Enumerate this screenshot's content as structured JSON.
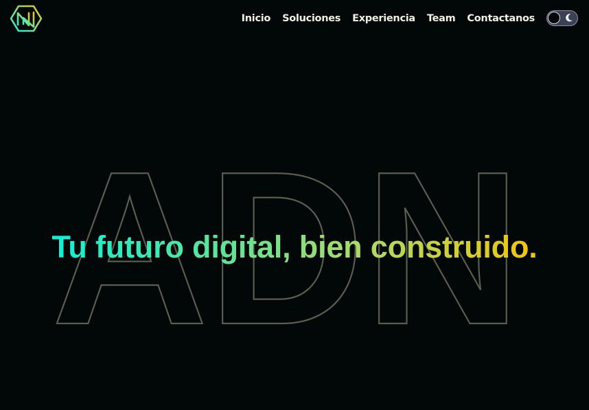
{
  "brand": {
    "logo_icon": "hexagon-n-logo-icon",
    "gradient_colors": [
      "#10f0d6",
      "#5ee39a",
      "#a8dc6a",
      "#f2c40a"
    ]
  },
  "nav": {
    "items": [
      {
        "label": "Inicio"
      },
      {
        "label": "Soluciones"
      },
      {
        "label": "Experiencia"
      },
      {
        "label": "Team"
      },
      {
        "label": "Contactanos"
      }
    ]
  },
  "theme_toggle": {
    "icon": "moon-icon",
    "mode": "dark"
  },
  "hero": {
    "background_word": "ADN",
    "title": "Tu futuro digital, bien construido."
  },
  "colors": {
    "background": "#020807",
    "nav_text": "#f2efe0",
    "outline_text": "#5a5d4f"
  }
}
